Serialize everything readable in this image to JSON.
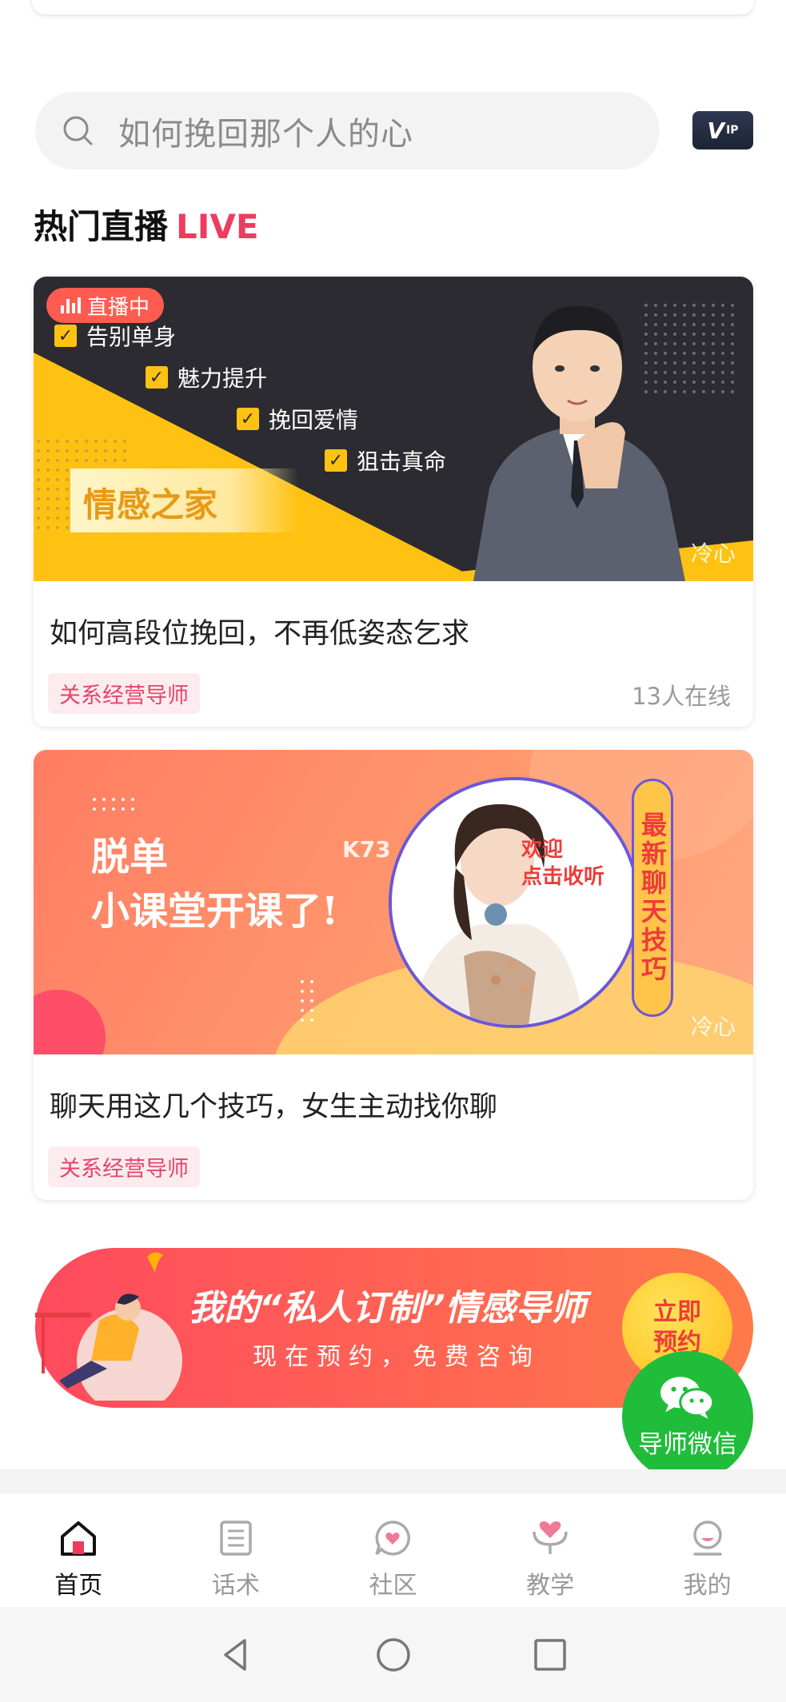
{
  "search": {
    "placeholder": "如何挽回那个人的心"
  },
  "vip": {
    "label": "V",
    "sub": "IP"
  },
  "section": {
    "title": "热门直播",
    "live": "LIVE"
  },
  "cards": [
    {
      "badge": "直播中",
      "checks": [
        "告别单身",
        "魅力提升",
        "挽回爱情",
        "狙击真命"
      ],
      "brand": "情感之家",
      "watermark": "冷心",
      "title": "如何高段位挽回，不再低姿态乞求",
      "tag": "关系经营导师",
      "online": "13人在线"
    },
    {
      "headline": [
        "脱单",
        "小课堂开课了!"
      ],
      "welcome": [
        "欢迎",
        "点击收听"
      ],
      "vertical": "最新聊天技巧",
      "k73": "K73",
      "watermark": "冷心",
      "title": "聊天用这几个技巧，女生主动找你聊",
      "tag": "关系经营导师"
    }
  ],
  "promo": {
    "line1": "我的“私人订制”情感导师",
    "line2": "现在预约，免费咨询",
    "button": "立即预约",
    "fab": "导师微信"
  },
  "tabs": [
    {
      "label": "首页",
      "icon": "home-icon",
      "active": true
    },
    {
      "label": "话术",
      "icon": "script-icon",
      "active": false
    },
    {
      "label": "社区",
      "icon": "community-icon",
      "active": false
    },
    {
      "label": "教学",
      "icon": "teaching-icon",
      "active": false
    },
    {
      "label": "我的",
      "icon": "profile-icon",
      "active": false
    }
  ],
  "colors": {
    "accent": "#ef3b5e",
    "yellow": "#ffc212",
    "wechat": "#1fbd3a"
  }
}
